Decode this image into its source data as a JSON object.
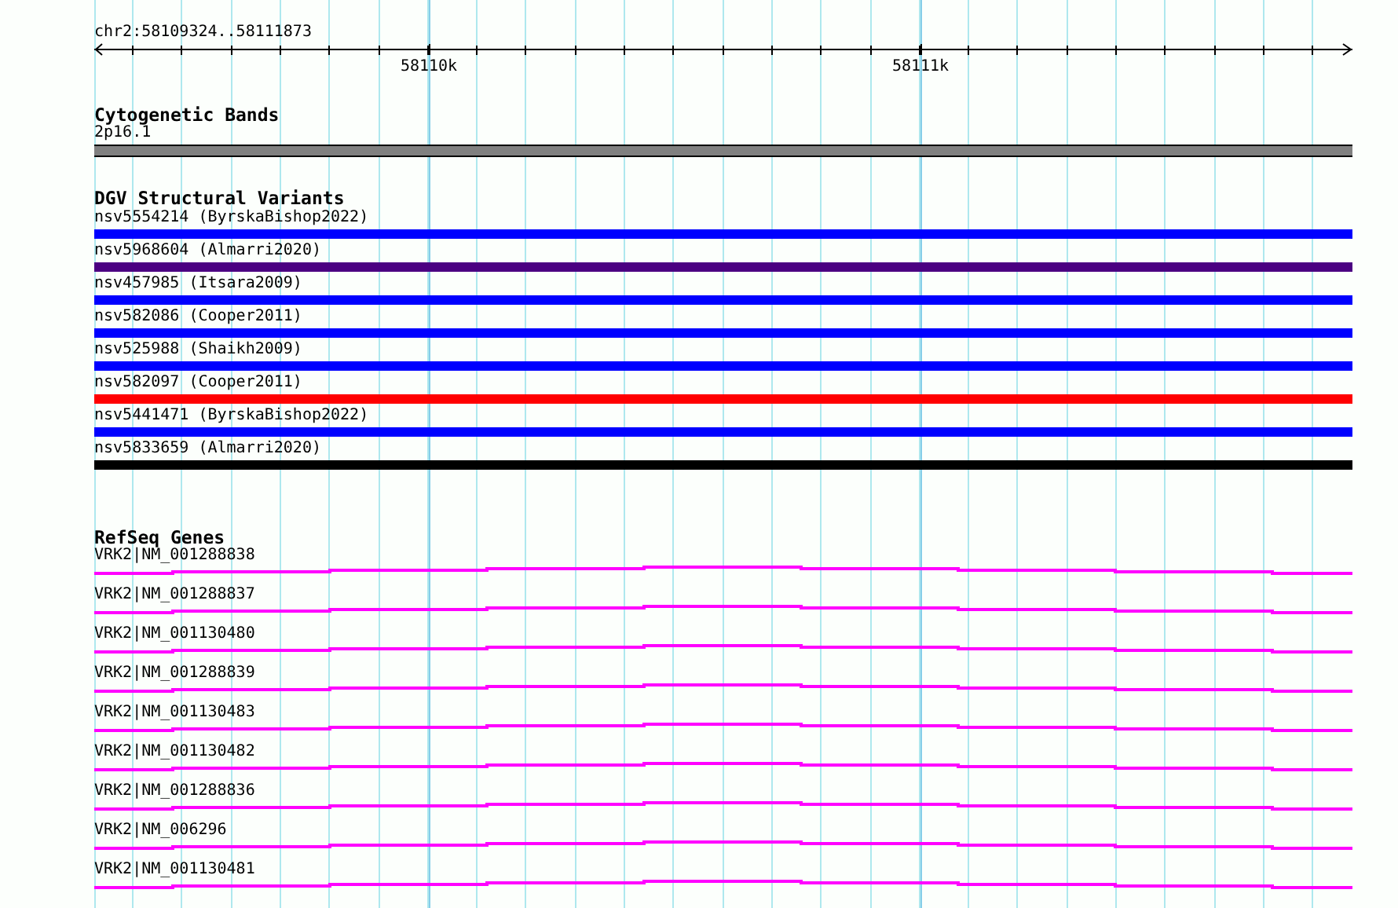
{
  "ruler": {
    "location": "chr2:58109324..58111873",
    "tick_labels": [
      "58110k",
      "58111k"
    ]
  },
  "cytogenetic_bands": {
    "title": "Cytogenetic Bands",
    "features": [
      {
        "label": "2p16.1",
        "color": "#808080"
      }
    ]
  },
  "dgv_structural_variants": {
    "title": "DGV Structural Variants",
    "features": [
      {
        "label": "nsv5554214 (ByrskaBishop2022)",
        "color": "#0000ff"
      },
      {
        "label": "nsv5968604 (Almarri2020)",
        "color": "#4b0082"
      },
      {
        "label": "nsv457985 (Itsara2009)",
        "color": "#0000ff"
      },
      {
        "label": "nsv582086 (Cooper2011)",
        "color": "#0000ff"
      },
      {
        "label": "nsv525988 (Shaikh2009)",
        "color": "#0000ff"
      },
      {
        "label": "nsv582097 (Cooper2011)",
        "color": "#ff0000"
      },
      {
        "label": "nsv5441471 (ByrskaBishop2022)",
        "color": "#0000ff"
      },
      {
        "label": "nsv5833659 (Almarri2020)",
        "color": "#000000"
      }
    ]
  },
  "refseq_genes": {
    "title": "RefSeq Genes",
    "features": [
      {
        "label": "VRK2|NM_001288838"
      },
      {
        "label": "VRK2|NM_001288837"
      },
      {
        "label": "VRK2|NM_001130480"
      },
      {
        "label": "VRK2|NM_001288839"
      },
      {
        "label": "VRK2|NM_001130483"
      },
      {
        "label": "VRK2|NM_001130482"
      },
      {
        "label": "VRK2|NM_001288836"
      },
      {
        "label": "VRK2|NM_006296"
      },
      {
        "label": "VRK2|NM_001130481"
      }
    ]
  }
}
